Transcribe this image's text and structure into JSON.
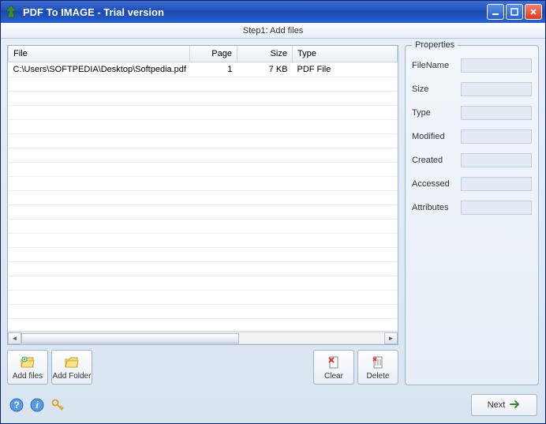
{
  "titlebar": {
    "title": "PDF To IMAGE - Trial version"
  },
  "step_label": "Step1: Add files",
  "table": {
    "headers": {
      "file": "File",
      "page": "Page",
      "size": "Size",
      "type": "Type"
    },
    "rows": [
      {
        "file": "C:\\Users\\SOFTPEDIA\\Desktop\\Softpedia.pdf",
        "page": "1",
        "size": "7 KB",
        "type": "PDF File"
      }
    ]
  },
  "buttons": {
    "add_files": "Add files",
    "add_folder": "Add Folder",
    "clear": "Clear",
    "delete": "Delete",
    "next": "Next"
  },
  "properties": {
    "group_label": "Properties",
    "filename_label": "FileName",
    "size_label": "Size",
    "type_label": "Type",
    "modified_label": "Modified",
    "created_label": "Created",
    "accessed_label": "Accessed",
    "attributes_label": "Attributes",
    "filename": "",
    "size": "",
    "type": "",
    "modified": "",
    "created": "",
    "accessed": "",
    "attributes": ""
  }
}
